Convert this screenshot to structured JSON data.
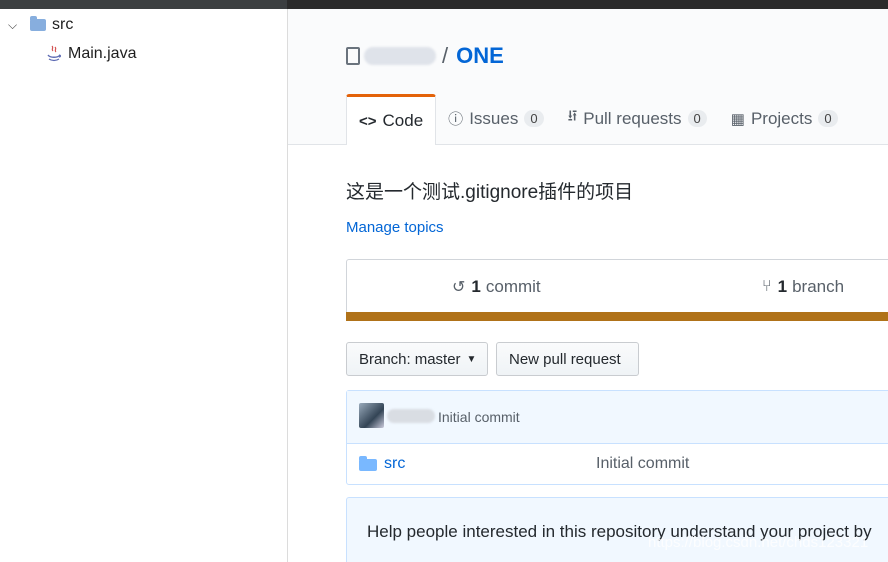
{
  "tree": {
    "folder_label": "src",
    "file_label": "Main.java"
  },
  "repo": {
    "owner_blurred": "",
    "separator": "/",
    "name": "ONE"
  },
  "tabs": [
    {
      "label": "Code",
      "count": null,
      "icon": "code-icon"
    },
    {
      "label": "Issues",
      "count": "0",
      "icon": "issue-icon"
    },
    {
      "label": "Pull requests",
      "count": "0",
      "icon": "pull-request-icon"
    },
    {
      "label": "Projects",
      "count": "0",
      "icon": "project-icon"
    }
  ],
  "description": "这是一个测试.gitignore插件的项目",
  "manage_topics": "Manage topics",
  "summary": {
    "commits_count": "1",
    "commits_label": "commit",
    "branches_count": "1",
    "branches_label": "branch"
  },
  "language_color": "#b07219",
  "buttons": {
    "branch_prefix": "Branch: ",
    "branch_name": "master",
    "new_pr": "New pull request"
  },
  "latest_commit": {
    "message": "Initial commit"
  },
  "files": [
    {
      "name": "src",
      "message": "Initial commit",
      "icon": "folder-icon"
    }
  ],
  "readme_prompt": "Help people interested in this repository understand your project by",
  "watermark": "https://blog.csdn.net/chds123321"
}
